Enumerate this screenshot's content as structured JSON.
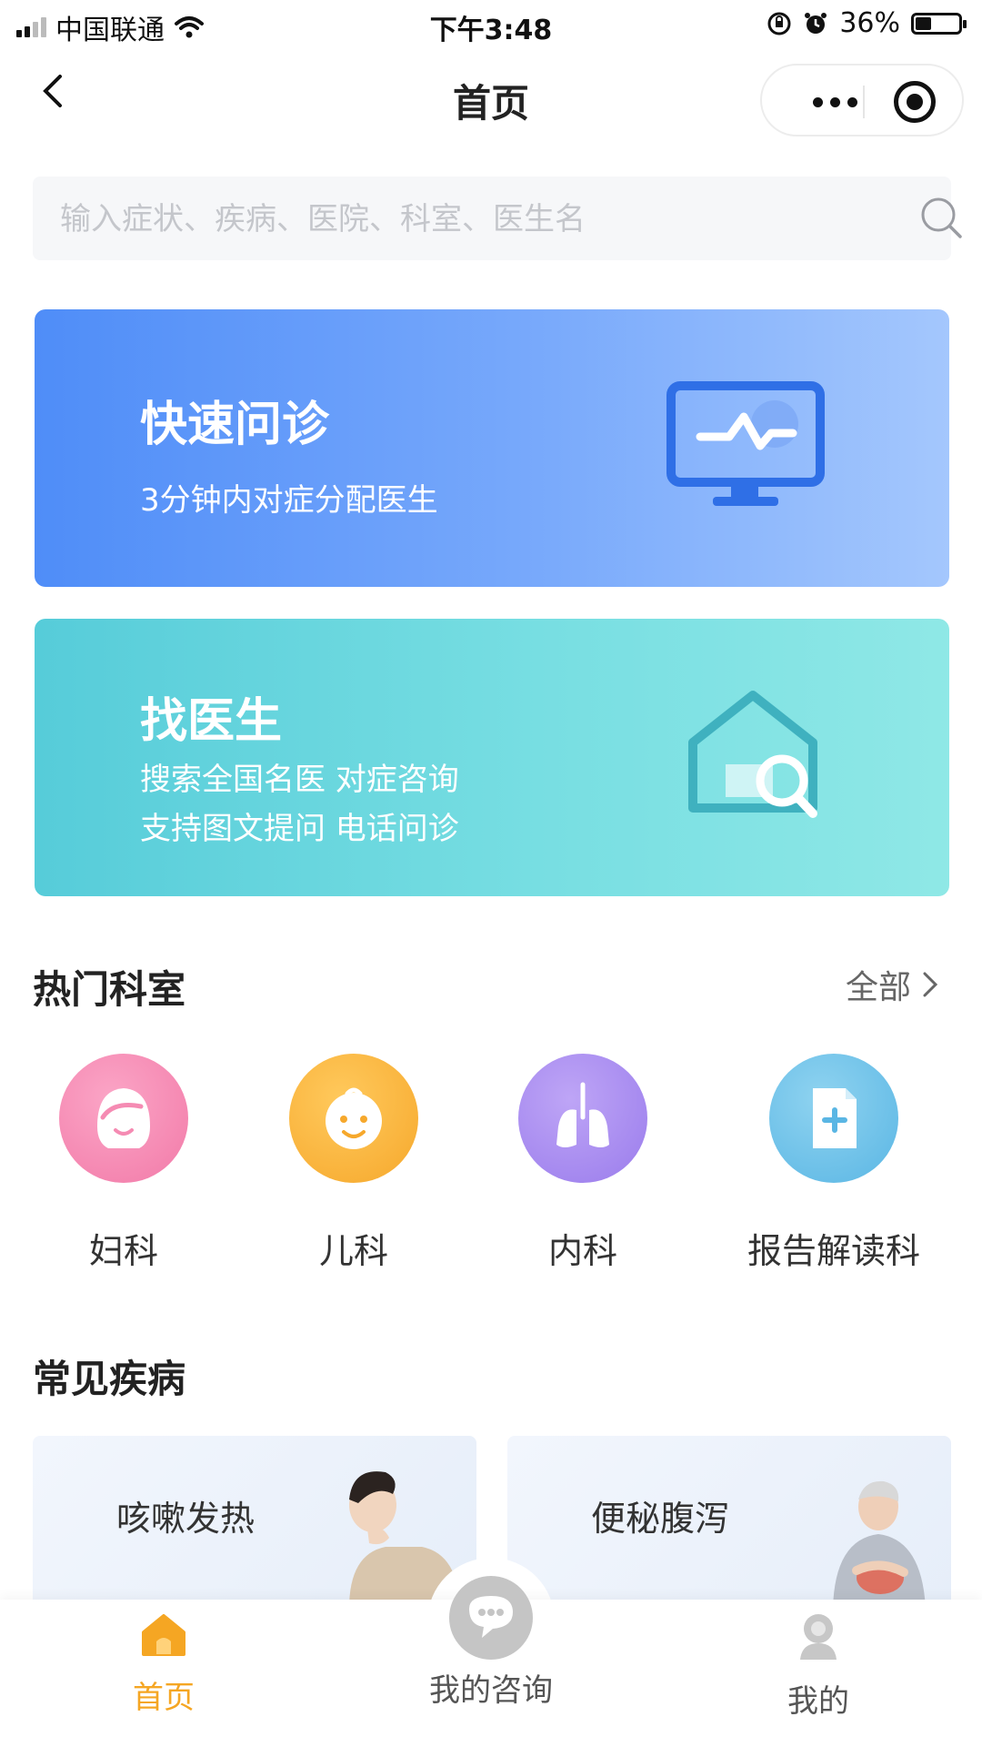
{
  "status_bar": {
    "carrier": "中国联通",
    "time": "下午3:48",
    "battery_percent": "36%",
    "battery_level": 0.36
  },
  "nav": {
    "title": "首页",
    "back_icon": "chevron-left-icon",
    "more_icon": "more-dots-icon",
    "close_icon": "target-circle-icon"
  },
  "search": {
    "placeholder": "输入症状、疾病、医院、科室、医生名",
    "value": ""
  },
  "cards": [
    {
      "title": "快速问诊",
      "subtitle_lines": [
        "3分钟内对症分配医生"
      ],
      "icon": "monitor-pulse-icon",
      "color": "#5b93f8"
    },
    {
      "title": "找医生",
      "subtitle_lines": [
        "搜索全国名医 对症咨询",
        "支持图文提问 电话问诊"
      ],
      "icon": "house-search-icon",
      "color": "#63d4dd"
    }
  ],
  "hot_departments": {
    "title": "热门科室",
    "all_label": "全部",
    "items": [
      {
        "label": "妇科",
        "icon": "woman-face-icon",
        "color": "#f58bb3"
      },
      {
        "label": "儿科",
        "icon": "baby-face-icon",
        "color": "#f8b43c"
      },
      {
        "label": "内科",
        "icon": "lungs-icon",
        "color": "#a98cf2"
      },
      {
        "label": "报告解读科",
        "icon": "document-plus-icon",
        "color": "#6cc3ea"
      }
    ]
  },
  "common_diseases": {
    "title": "常见疾病",
    "items": [
      {
        "label": "咳嗽发热",
        "image": "coughing-woman-photo"
      },
      {
        "label": "便秘腹泻",
        "image": "stomach-pain-man-photo"
      }
    ]
  },
  "tabbar": {
    "items": [
      {
        "label": "首页",
        "icon": "home-icon",
        "active": true
      },
      {
        "label": "我的咨询",
        "icon": "chat-bubble-icon",
        "active": false
      },
      {
        "label": "我的",
        "icon": "user-icon",
        "active": false
      }
    ],
    "active_color": "#f5a623",
    "inactive_color": "#555555"
  }
}
